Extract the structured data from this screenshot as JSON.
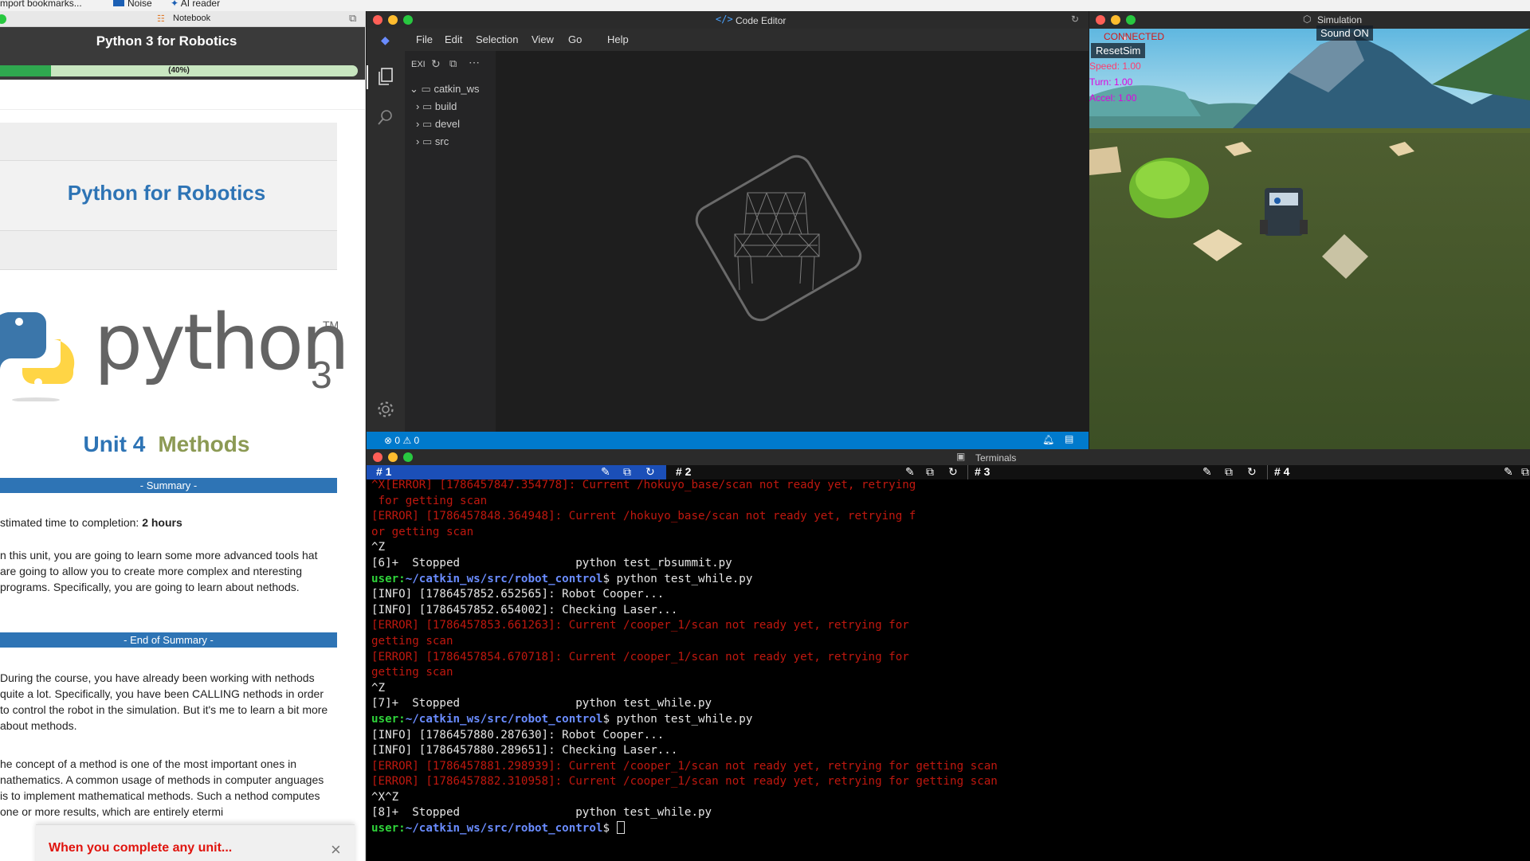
{
  "bookmarks": {
    "items": [
      "mport bookmarks...",
      "Noise",
      "AI reader"
    ]
  },
  "notebook": {
    "window_title": "Notebook",
    "course_title": "Python 3 for Robotics",
    "progress": 0.4,
    "progress_label": "(40%)",
    "page_title": "Python for Robotics",
    "logo_word": "python",
    "logo_version": "3",
    "logo_tm": "TM",
    "unit_number": "Unit 4",
    "unit_name": "Methods",
    "summary_label": "- Summary -",
    "time_label": "stimated time to completion:",
    "time_value": "2 hours",
    "para1": "n this unit, you are going to learn some more advanced tools hat are going to allow you to create more complex and nteresting programs. Specifically, you are going to learn about nethods.",
    "end_summary_label": "- End of Summary -",
    "para2": "During the course, you have already been working with nethods quite a lot. Specifically, you have been CALLING nethods in order to control the robot in the simulation. But it's me to learn a bit more about methods.",
    "para3": "he concept of a method is one of the most important ones in nathematics. A common usage of methods in computer anguages is to implement mathematical methods. Such a nethod computes one or more results, which are entirely etermi",
    "toast_text": "When you complete any unit...",
    "toast_close": "×"
  },
  "editor": {
    "window_title": "Code Editor",
    "menu": [
      "File",
      "Edit",
      "Selection",
      "View",
      "Go",
      "Help"
    ],
    "explorer_label": "EXI",
    "tree": [
      {
        "label": "catkin_ws",
        "expanded": true
      },
      {
        "label": "build",
        "expanded": false
      },
      {
        "label": "devel",
        "expanded": false
      },
      {
        "label": "src",
        "expanded": false
      }
    ],
    "status_errors": "0",
    "status_warnings": "0"
  },
  "simulation": {
    "window_title": "Simulation",
    "connected": "CONNECTED",
    "sound_button": "Sound ON",
    "reset_button": "ResetSim",
    "speed": "Speed: 1.00",
    "turn": "Turn: 1.00",
    "accel": "Accel: 1.00"
  },
  "terminals": {
    "window_title": "Terminals",
    "tabs": [
      "# 1",
      "# 2",
      "# 3",
      "# 4"
    ],
    "prompt_user": "user:",
    "prompt_path": "~/catkin_ws/src/robot_control",
    "prompt_symbol": "$",
    "lines": [
      {
        "type": "err",
        "text": "^X[ERROR] [1786457847.354778]: Current /hokuyo_base/scan not ready yet, retrying"
      },
      {
        "type": "err",
        "text": " for getting scan"
      },
      {
        "type": "err",
        "text": "[ERROR] [1786457848.364948]: Current /hokuyo_base/scan not ready yet, retrying f"
      },
      {
        "type": "err",
        "text": "or getting scan"
      },
      {
        "type": "out",
        "text": "^Z"
      },
      {
        "type": "out",
        "text": "[6]+  Stopped                 python test_rbsummit.py"
      },
      {
        "type": "prompt",
        "text": " python test_while.py"
      },
      {
        "type": "out",
        "text": "[INFO] [1786457852.652565]: Robot Cooper..."
      },
      {
        "type": "out",
        "text": "[INFO] [1786457852.654002]: Checking Laser..."
      },
      {
        "type": "err",
        "text": "[ERROR] [1786457853.661263]: Current /cooper_1/scan not ready yet, retrying for"
      },
      {
        "type": "err",
        "text": "getting scan"
      },
      {
        "type": "err",
        "text": "[ERROR] [1786457854.670718]: Current /cooper_1/scan not ready yet, retrying for"
      },
      {
        "type": "err",
        "text": "getting scan"
      },
      {
        "type": "out",
        "text": "^Z"
      },
      {
        "type": "out",
        "text": "[7]+  Stopped                 python test_while.py"
      },
      {
        "type": "prompt",
        "text": " python test_while.py"
      },
      {
        "type": "out",
        "text": "[INFO] [1786457880.287630]: Robot Cooper..."
      },
      {
        "type": "out",
        "text": "[INFO] [1786457880.289651]: Checking Laser..."
      },
      {
        "type": "err",
        "text": "[ERROR] [1786457881.298939]: Current /cooper_1/scan not ready yet, retrying for getting scan"
      },
      {
        "type": "err",
        "text": "[ERROR] [1786457882.310958]: Current /cooper_1/scan not ready yet, retrying for getting scan"
      },
      {
        "type": "out",
        "text": "^X^Z"
      },
      {
        "type": "out",
        "text": "[8]+  Stopped                 python test_while.py"
      },
      {
        "type": "prompt_cursor",
        "text": " "
      }
    ]
  }
}
